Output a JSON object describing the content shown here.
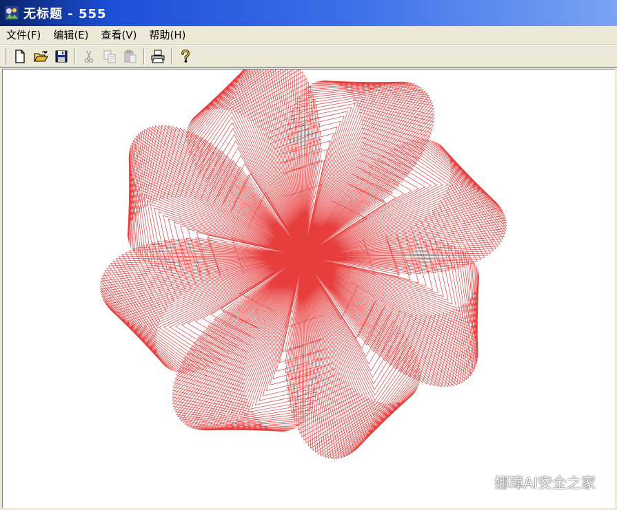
{
  "window": {
    "title": "无标题 - 555",
    "title_color": "#ffffff",
    "titlebar_color": "#1c4fd8"
  },
  "menu": {
    "items": [
      {
        "label": "文件(F)"
      },
      {
        "label": "编辑(E)"
      },
      {
        "label": "查看(V)"
      },
      {
        "label": "帮助(H)"
      }
    ]
  },
  "toolbar": {
    "buttons": [
      {
        "icon": "new-document-icon",
        "enabled": true
      },
      {
        "icon": "open-folder-icon",
        "enabled": true
      },
      {
        "icon": "save-icon",
        "enabled": true
      },
      {
        "icon": "cut-icon",
        "enabled": false
      },
      {
        "icon": "copy-icon",
        "enabled": false
      },
      {
        "icon": "paste-icon",
        "enabled": false
      },
      {
        "icon": "print-icon",
        "enabled": true
      },
      {
        "icon": "help-icon",
        "enabled": true
      }
    ]
  },
  "drawing": {
    "shape": "rotated-line-pattern",
    "petals": 8,
    "stroke_color": "#e21b1b"
  },
  "watermark": {
    "text": "娜璋AI安全之家",
    "icon": "wechat-icon"
  }
}
